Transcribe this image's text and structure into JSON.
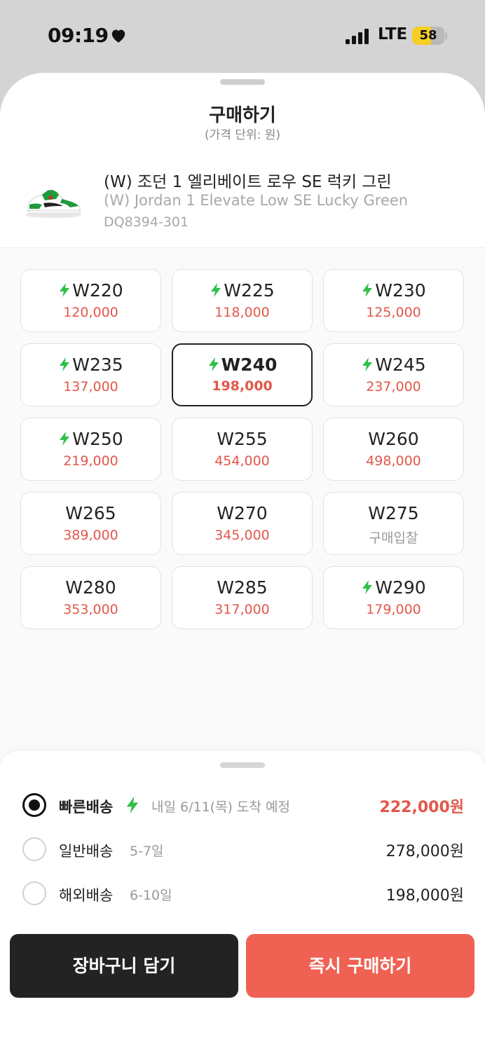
{
  "status_bar": {
    "time": "09:19",
    "network": "LTE",
    "battery": "58",
    "battery_level": 0.58,
    "heart_icon": "heart-icon",
    "signal_icon": "signal-bars-icon"
  },
  "sheet": {
    "title": "구매하기",
    "subtitle": "(가격 단위: 원)"
  },
  "product": {
    "name_ko": "(W) 조던 1 엘리베이트 로우 SE 럭키 그린",
    "name_en": "(W) Jordan 1 Elevate Low SE Lucky Green",
    "code": "DQ8394-301",
    "image_icon": "sneaker-thumbnail"
  },
  "sizes": [
    {
      "label": "W220",
      "price": "120,000",
      "fast": true,
      "selected": false
    },
    {
      "label": "W225",
      "price": "118,000",
      "fast": true,
      "selected": false
    },
    {
      "label": "W230",
      "price": "125,000",
      "fast": true,
      "selected": false
    },
    {
      "label": "W235",
      "price": "137,000",
      "fast": true,
      "selected": false
    },
    {
      "label": "W240",
      "price": "198,000",
      "fast": true,
      "selected": true
    },
    {
      "label": "W245",
      "price": "237,000",
      "fast": true,
      "selected": false
    },
    {
      "label": "W250",
      "price": "219,000",
      "fast": true,
      "selected": false
    },
    {
      "label": "W255",
      "price": "454,000",
      "fast": false,
      "selected": false
    },
    {
      "label": "W260",
      "price": "498,000",
      "fast": false,
      "selected": false
    },
    {
      "label": "W265",
      "price": "389,000",
      "fast": false,
      "selected": false
    },
    {
      "label": "W270",
      "price": "345,000",
      "fast": false,
      "selected": false
    },
    {
      "label": "W275",
      "price": "구매입찰",
      "fast": false,
      "selected": false,
      "muted": true
    },
    {
      "label": "W280",
      "price": "353,000",
      "fast": false,
      "selected": false
    },
    {
      "label": "W285",
      "price": "317,000",
      "fast": false,
      "selected": false
    },
    {
      "label": "W290",
      "price": "179,000",
      "fast": true,
      "selected": false
    }
  ],
  "shipping": {
    "fast": {
      "name": "빠른배송",
      "desc": "내일 6/11(목) 도착 예정",
      "price": "222,000원",
      "checked": true
    },
    "normal": {
      "name": "일반배송",
      "desc": "5-7일",
      "price": "278,000원",
      "checked": false
    },
    "overseas": {
      "name": "해외배송",
      "desc": "6-10일",
      "price": "198,000원",
      "checked": false
    }
  },
  "buttons": {
    "cart": "장바구니 담기",
    "buy": "즉시 구매하기"
  },
  "colors": {
    "accent_red": "#ef6253",
    "price_red": "#e2574a",
    "bolt_green": "#2fc04a",
    "dark": "#232323"
  }
}
